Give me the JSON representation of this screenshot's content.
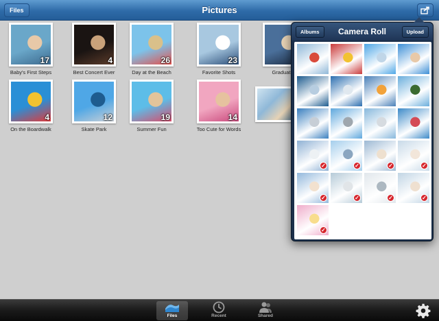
{
  "navbar": {
    "title": "Pictures",
    "files_button": "Files"
  },
  "albums": [
    {
      "label": "Baby's First Steps",
      "count": "17",
      "colors": [
        "#6aa7c9",
        "#e8c9a8",
        "#3d6b8f"
      ]
    },
    {
      "label": "Best Concert Ever",
      "count": "4",
      "colors": [
        "#1a1412",
        "#c9a27a",
        "#5b3b2a"
      ]
    },
    {
      "label": "Day at the Beach",
      "count": "26",
      "colors": [
        "#7cc3ea",
        "#d9c08a",
        "#e4504b"
      ]
    },
    {
      "label": "Favorite Shots",
      "count": "23",
      "colors": [
        "#a8c8e0",
        "#ffffff",
        "#2d4f7a"
      ]
    },
    {
      "label": "Graduation",
      "count": "",
      "colors": [
        "#4a6f9a",
        "#e6d2b5",
        "#1b2a40"
      ]
    },
    {
      "label": "On the Boardwalk",
      "count": "4",
      "colors": [
        "#2a8fd6",
        "#f2c230",
        "#e03a3a"
      ]
    },
    {
      "label": "Skate Park",
      "count": "12",
      "colors": [
        "#4fa7e6",
        "#1e5c8f",
        "#c9cfd6"
      ]
    },
    {
      "label": "Summer Fun",
      "count": "19",
      "colors": [
        "#5dbde8",
        "#e3c49a",
        "#d94b6a"
      ]
    },
    {
      "label": "Too Cute for Words",
      "count": "14",
      "colors": [
        "#f1a6c0",
        "#e6c29f",
        "#c94a7d"
      ]
    }
  ],
  "popover": {
    "title": "Camera Roll",
    "albums_button": "Albums",
    "upload_button": "Upload",
    "photos": [
      {
        "colors": [
          "#8fb8d8",
          "#d94b3b"
        ],
        "selected": false
      },
      {
        "colors": [
          "#c93a3a",
          "#f2c230"
        ],
        "selected": false
      },
      {
        "colors": [
          "#4fa7e6",
          "#c0d6e8"
        ],
        "selected": false
      },
      {
        "colors": [
          "#3d8fd6",
          "#e8c9a8"
        ],
        "selected": false
      },
      {
        "colors": [
          "#1e5c8f",
          "#b7cde0"
        ],
        "selected": false
      },
      {
        "colors": [
          "#2d6fb0",
          "#e0e8ef"
        ],
        "selected": false
      },
      {
        "colors": [
          "#4a80b8",
          "#f2a23a"
        ],
        "selected": false
      },
      {
        "colors": [
          "#6aaedc",
          "#3b6b30"
        ],
        "selected": false
      },
      {
        "colors": [
          "#3a7fbf",
          "#c7ced6"
        ],
        "selected": false
      },
      {
        "colors": [
          "#5fa8dd",
          "#9fa7ae"
        ],
        "selected": false
      },
      {
        "colors": [
          "#87b8dc",
          "#d6dbe0"
        ],
        "selected": false
      },
      {
        "colors": [
          "#3d8ac8",
          "#d44a55"
        ],
        "selected": false
      },
      {
        "colors": [
          "#3472b2",
          "#dfe6ec"
        ],
        "selected": true
      },
      {
        "colors": [
          "#5aa6dd",
          "#2d5e8c"
        ],
        "selected": true
      },
      {
        "colors": [
          "#4c7fb0",
          "#e0c6a8"
        ],
        "selected": true
      },
      {
        "colors": [
          "#9cbcd6",
          "#e8d2bc"
        ],
        "selected": true
      },
      {
        "colors": [
          "#3b7fc0",
          "#e8c9a8"
        ],
        "selected": true
      },
      {
        "colors": [
          "#7aa0b8",
          "#c9cfd6"
        ],
        "selected": true
      },
      {
        "colors": [
          "#c8d3dc",
          "#6b7f8f"
        ],
        "selected": true
      },
      {
        "colors": [
          "#8fb3cf",
          "#e2c6aa"
        ],
        "selected": true
      },
      {
        "colors": [
          "#e36aa0",
          "#f2c230"
        ],
        "selected": true
      }
    ]
  },
  "tabbar": {
    "tabs": [
      {
        "label": "Files",
        "icon": "files-icon",
        "active": true
      },
      {
        "label": "Recent",
        "icon": "clock-icon",
        "active": false
      },
      {
        "label": "Shared",
        "icon": "people-icon",
        "active": false
      }
    ],
    "settings_icon": "gear-icon"
  },
  "colors": {
    "nav_blue": "#2e6ba8",
    "popover_navy": "#1b2f4a",
    "check_red": "#d6262d"
  }
}
